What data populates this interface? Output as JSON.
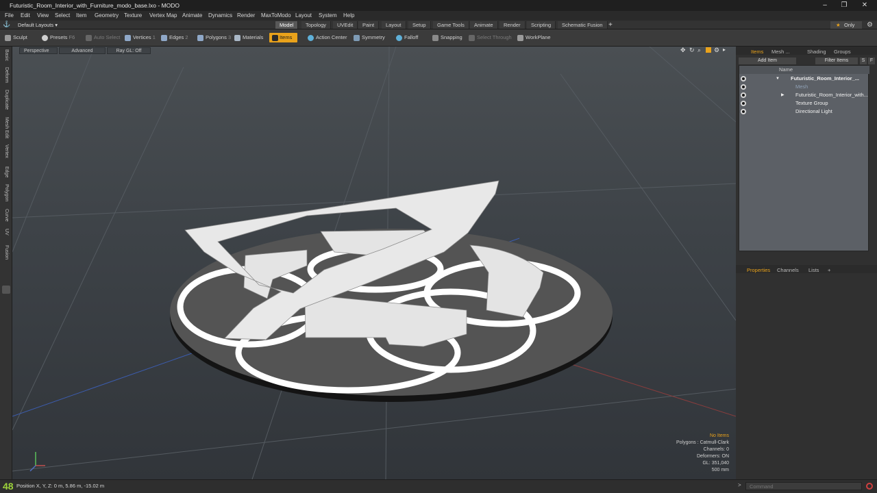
{
  "window": {
    "title": "Futuristic_Room_Interior_with_Furniture_modo_base.lxo - MODO"
  },
  "menu": [
    "File",
    "Edit",
    "View",
    "Select",
    "Item",
    "Geometry",
    "Texture",
    "Vertex Map",
    "Animate",
    "Dynamics",
    "Render",
    "MaxToModo",
    "Layout",
    "System",
    "Help"
  ],
  "layout": {
    "selector": "Default Layouts ▾",
    "tabs": [
      "Model",
      "Topology",
      "UVEdit",
      "Paint",
      "Layout",
      "Setup",
      "Game Tools",
      "Animate",
      "Render",
      "Scripting",
      "Schematic Fusion"
    ],
    "active_tab": "Model",
    "add": "+",
    "only": "Only"
  },
  "toolbar": {
    "sculpt": "Sculpt",
    "presets": "Presets",
    "presets_key": "F6",
    "auto_select": "Auto Select",
    "vertices": "Vertices",
    "vertices_key": "1",
    "edges": "Edges",
    "edges_key": "2",
    "polygons": "Polygons",
    "polygons_key": "3",
    "materials": "Materials",
    "items": "Items",
    "action_center": "Action Center",
    "symmetry": "Symmetry",
    "falloff": "Falloff",
    "snapping": "Snapping",
    "select_through": "Select Through",
    "workplane": "WorkPlane"
  },
  "left_tabs": [
    "Basic",
    "Deform",
    "Duplicate",
    "Mesh Edit",
    "Vertex",
    "Edge",
    "Polygon",
    "Curve",
    "UV",
    "Fusion"
  ],
  "viewport": {
    "view": "Perspective",
    "shading": "Advanced",
    "raygl": "Ray GL: Off",
    "info": {
      "selection": "No Items",
      "polygons": "Polygons : Catmull-Clark",
      "channels": "Channels: 0",
      "deformers": "Deformers: ON",
      "gl": "GL: 351,040",
      "scale": "500 mm"
    }
  },
  "items_panel": {
    "tabs": [
      "Items",
      "Mesh ...",
      "Shading",
      "Groups"
    ],
    "add_item": "Add Item",
    "filter_items": "Filter Items",
    "col_s": "S",
    "col_f": "F",
    "col_name": "Name",
    "rows": [
      {
        "name": "Futuristic_Room_Interior_..."
      },
      {
        "name": "Mesh"
      },
      {
        "name": "Futuristic_Room_Interior_with..."
      },
      {
        "name": "Texture Group"
      },
      {
        "name": "Directional Light"
      }
    ]
  },
  "properties_panel": {
    "tabs": [
      "Properties",
      "Channels",
      "Lists",
      "+"
    ]
  },
  "status": {
    "big": "48",
    "position": "Position X, Y, Z:   0 m, 5.86 m, -15.02 m",
    "command_placeholder": "Command"
  },
  "colors": {
    "accent": "#e9a21b",
    "viewport_top": "#4a4f53",
    "viewport_bottom": "#31353a"
  }
}
